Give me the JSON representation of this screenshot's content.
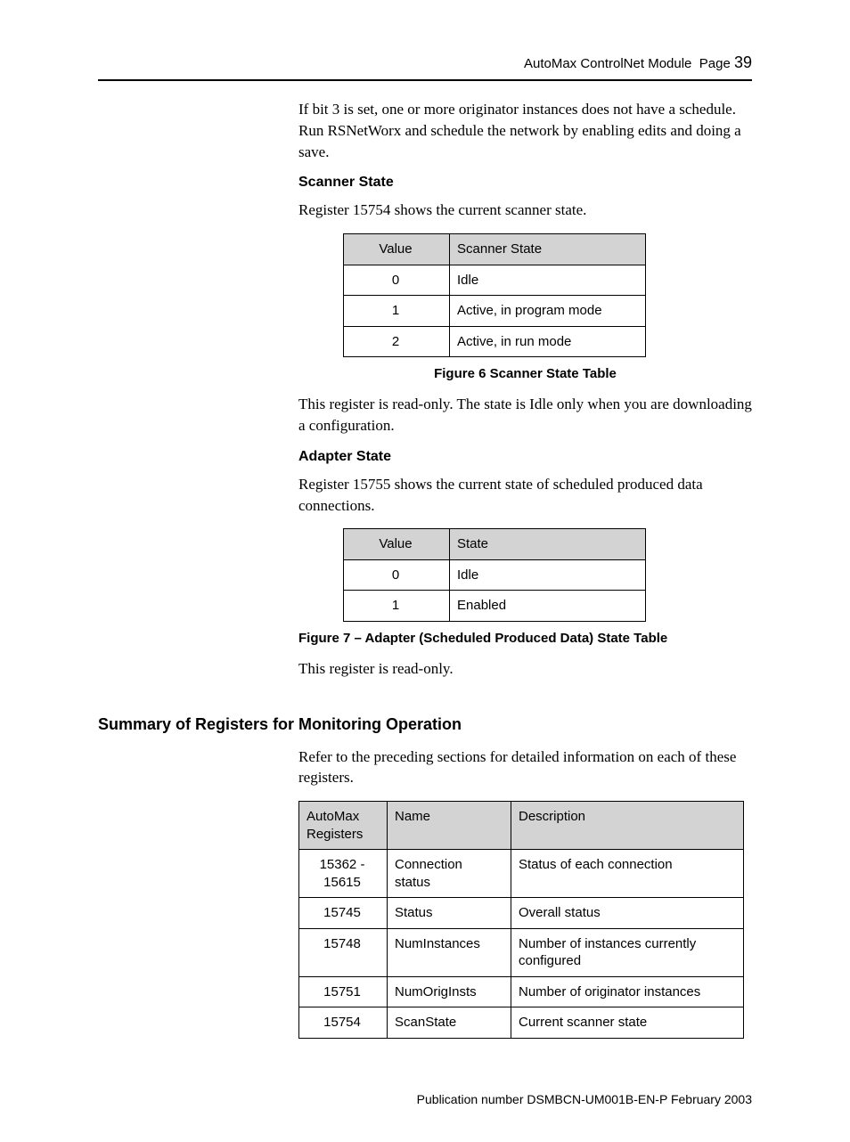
{
  "header": {
    "doc_title": "AutoMax ControlNet Module",
    "page_label": "Page",
    "page_number": "39"
  },
  "body": {
    "intro_para": "If bit 3 is set, one or more originator instances does not have a schedule. Run RSNetWorx and schedule the network by enabling edits and doing a save.",
    "scanner_state": {
      "heading": "Scanner State",
      "desc": "Register 15754 shows the current scanner state.",
      "table": {
        "headers": [
          "Value",
          "Scanner State"
        ],
        "rows": [
          [
            "0",
            "Idle"
          ],
          [
            "1",
            "Active, in program mode"
          ],
          [
            "2",
            "Active, in run mode"
          ]
        ]
      },
      "caption": "Figure 6 Scanner State Table",
      "note": "This register is read-only.  The state is Idle only when you are downloading a configuration."
    },
    "adapter_state": {
      "heading": "Adapter State",
      "desc": "Register 15755 shows the current state of scheduled produced data connections.",
      "table": {
        "headers": [
          "Value",
          "State"
        ],
        "rows": [
          [
            "0",
            "Idle"
          ],
          [
            "1",
            "Enabled"
          ]
        ]
      },
      "caption": "Figure 7 – Adapter (Scheduled Produced Data) State Table",
      "note": "This register is read-only."
    },
    "summary": {
      "heading": "Summary of Registers for Monitoring Operation",
      "desc": "Refer to the preceding sections for detailed information on each of these registers.",
      "table": {
        "headers": [
          "AutoMax Registers",
          "Name",
          "Description"
        ],
        "rows": [
          [
            "15362 - 15615",
            "Connection status",
            "Status of each connection"
          ],
          [
            "15745",
            "Status",
            "Overall status"
          ],
          [
            "15748",
            "NumInstances",
            "Number of instances currently configured"
          ],
          [
            "15751",
            "NumOrigInsts",
            "Number of originator instances"
          ],
          [
            "15754",
            "ScanState",
            "Current scanner state"
          ]
        ]
      }
    }
  },
  "footer": {
    "pub": "Publication number DSMBCN-UM001B-EN-P February 2003"
  }
}
